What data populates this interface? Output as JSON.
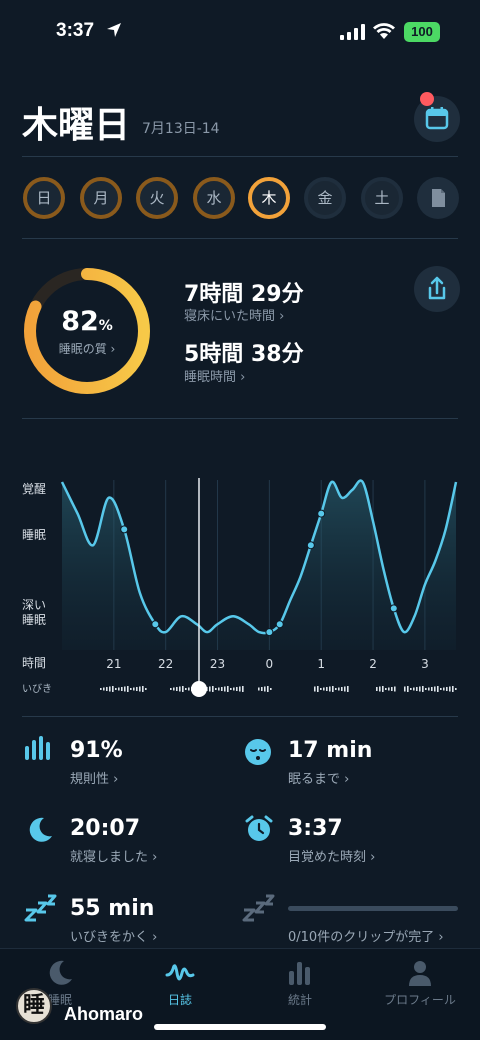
{
  "status": {
    "time": "3:37",
    "battery": "100"
  },
  "header": {
    "title": "木曜日",
    "date_range": "7月13日-14"
  },
  "days": [
    {
      "label": "日",
      "ring_color": "#8a5a1c",
      "selected": false
    },
    {
      "label": "月",
      "ring_color": "#8a5a1c",
      "selected": false
    },
    {
      "label": "火",
      "ring_color": "#8a5a1c",
      "selected": false
    },
    {
      "label": "水",
      "ring_color": "#8a5a1c",
      "selected": false
    },
    {
      "label": "木",
      "ring_color": "#f2a23a",
      "selected": true
    },
    {
      "label": "金",
      "ring_color": "#1f2e3d",
      "selected": false
    },
    {
      "label": "土",
      "ring_color": "#1f2e3d",
      "selected": false
    }
  ],
  "summary": {
    "quality_value": "82",
    "quality_unit": "%",
    "quality_fraction": 0.82,
    "quality_label": "睡眠の質 ›",
    "time_in_bed": "7時間 29分",
    "time_in_bed_label": "寝床にいた時間 ›",
    "sleep_time": "5時間 38分",
    "sleep_time_label": "睡眠時間 ›"
  },
  "chart_data": {
    "type": "area",
    "y_levels": [
      "覚醒",
      "睡眠",
      "深い\n睡眠"
    ],
    "x_axis_title": "時間",
    "x_ticks": [
      "21",
      "22",
      "23",
      "0",
      "1",
      "2",
      "3"
    ],
    "snore_label": "いびき",
    "x": [
      20.0,
      20.3,
      20.6,
      20.9,
      21.2,
      21.5,
      21.8,
      22.0,
      22.3,
      22.6,
      22.8,
      23.0,
      23.3,
      23.6,
      23.8,
      24.0,
      24.2,
      24.4,
      24.6,
      24.8,
      25.0,
      25.2,
      25.4,
      25.6,
      25.8,
      26.0,
      26.2,
      26.4,
      26.6,
      26.8,
      27.0,
      27.2,
      27.4,
      27.6
    ],
    "values": [
      2.0,
      1.6,
      1.2,
      1.8,
      1.4,
      0.6,
      0.2,
      0.1,
      0.3,
      0.2,
      0.1,
      0.2,
      0.3,
      0.2,
      0.1,
      0.1,
      0.2,
      0.5,
      0.8,
      1.2,
      1.6,
      2.0,
      1.8,
      1.9,
      2.0,
      1.5,
      0.9,
      0.4,
      0.1,
      0.3,
      0.7,
      1.0,
      1.4,
      2.0
    ],
    "y_range": [
      0,
      2
    ]
  },
  "metrics": {
    "regularity_value": "91%",
    "regularity_label": "規則性 ›",
    "fall_asleep_value": "17 min",
    "fall_asleep_label": "眠るまで ›",
    "bedtime_value": "20:07",
    "bedtime_label": "就寝しました ›",
    "wake_value": "3:37",
    "wake_label": "目覚めた時刻 ›",
    "snoring_value": "55 min",
    "snoring_label": "いびきをかく ›",
    "clips_label": "0/10件のクリップが完了 ›"
  },
  "tabs": [
    {
      "label": "睡眠",
      "icon": "moon-icon",
      "active": false
    },
    {
      "label": "日誌",
      "icon": "waveform-icon",
      "active": true
    },
    {
      "label": "統計",
      "icon": "bars-icon",
      "active": false
    },
    {
      "label": "プロフィール",
      "icon": "person-icon",
      "active": false
    }
  ],
  "user": {
    "avatar_glyph": "睡",
    "name": "Ahomaro"
  },
  "colors": {
    "accent": "#58c8ea",
    "ring_orange": "#f2a23a",
    "ring_yellow": "#f7c948",
    "bg": "#0f1a26"
  }
}
